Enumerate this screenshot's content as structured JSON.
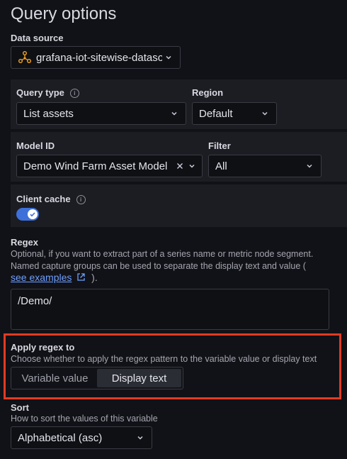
{
  "heading": "Query options",
  "data_source": {
    "label": "Data source",
    "value": "grafana-iot-sitewise-datasource"
  },
  "query_type": {
    "label": "Query type",
    "value": "List assets"
  },
  "region": {
    "label": "Region",
    "value": "Default"
  },
  "model_id": {
    "label": "Model ID",
    "value": "Demo Wind Farm Asset Model"
  },
  "filter": {
    "label": "Filter",
    "value": "All"
  },
  "client_cache": {
    "label": "Client cache",
    "enabled": true
  },
  "regex": {
    "label": "Regex",
    "desc_line1": "Optional, if you want to extract part of a series name or metric node segment.",
    "desc_line2": "Named capture groups can be used to separate the display text and value (",
    "link": "see examples",
    "desc_end": ").",
    "value": "/Demo/"
  },
  "apply_regex": {
    "label": "Apply regex to",
    "desc": "Choose whether to apply the regex pattern to the variable value or display text",
    "options": [
      "Variable value",
      "Display text"
    ],
    "selected": "Display text"
  },
  "sort": {
    "label": "Sort",
    "desc": "How to sort the values of this variable",
    "value": "Alphabetical (asc)"
  },
  "colors": {
    "highlight": "#e03b24",
    "accent": "#3d71d9",
    "link": "#6e9fff"
  }
}
